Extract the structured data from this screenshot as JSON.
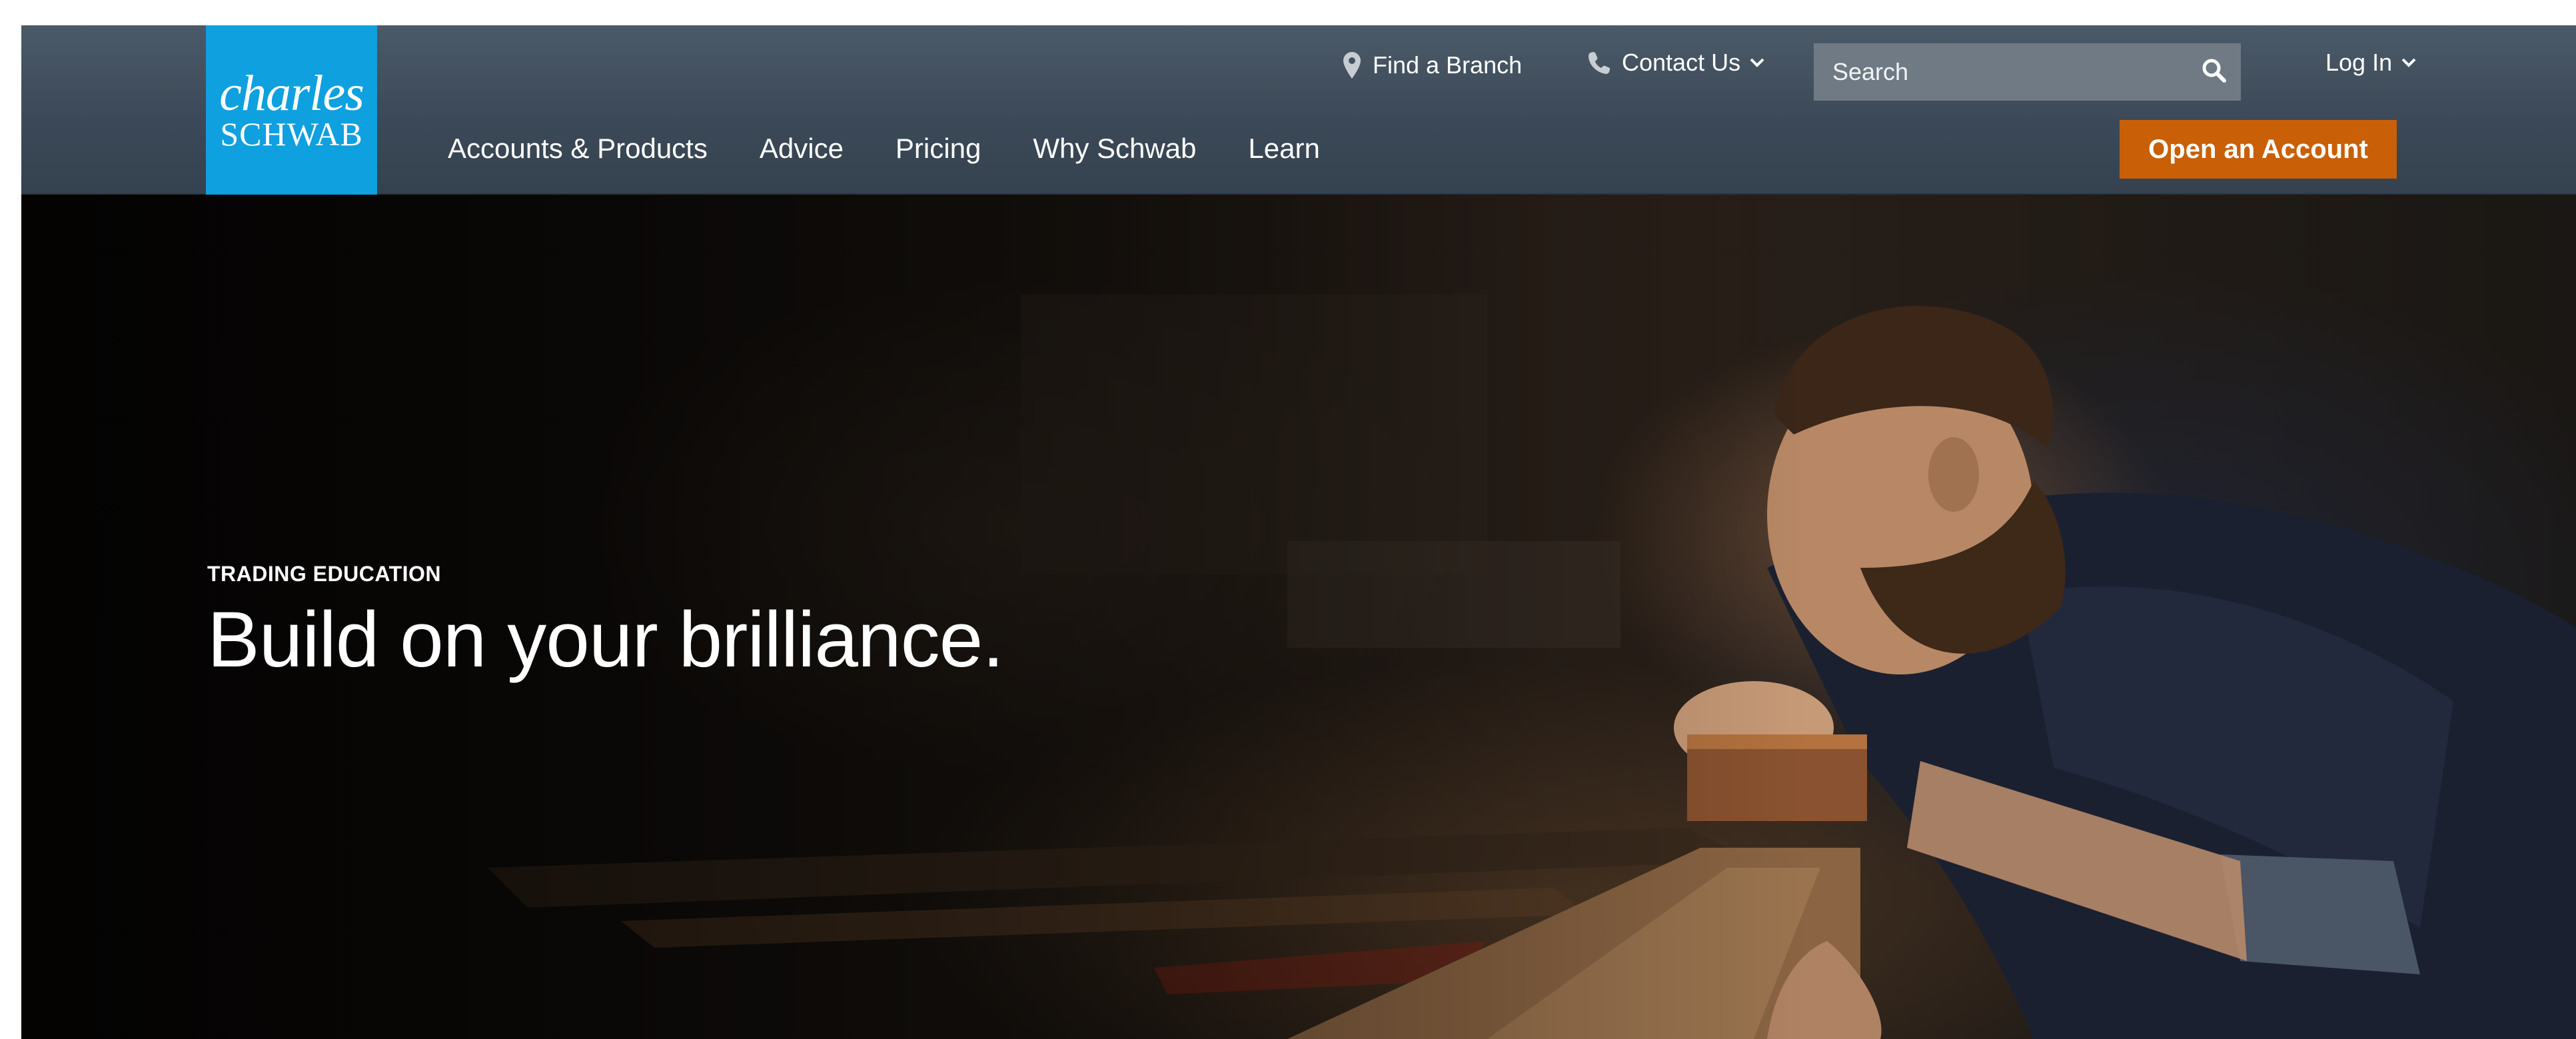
{
  "brand": {
    "logo_line1": "charles",
    "logo_line2": "SCHWAB",
    "logo_bg": "#0ea0df"
  },
  "utility": {
    "find_branch": "Find a Branch",
    "find_branch_icon": "map-pin-icon",
    "contact_us": "Contact Us",
    "contact_icon": "phone-icon",
    "login": "Log In"
  },
  "search": {
    "placeholder": "Search",
    "value": "",
    "icon": "search-icon"
  },
  "nav": {
    "items": [
      {
        "label": "Accounts & Products"
      },
      {
        "label": "Advice"
      },
      {
        "label": "Pricing"
      },
      {
        "label": "Why Schwab"
      },
      {
        "label": "Learn"
      }
    ]
  },
  "cta": {
    "label": "Open an Account",
    "color": "#c95f06"
  },
  "hero": {
    "eyebrow": "TRADING EDUCATION",
    "headline": "Build on your brilliance.",
    "image": "craftsman-sanding-wood-photo"
  }
}
